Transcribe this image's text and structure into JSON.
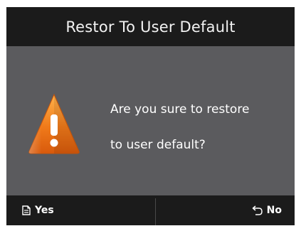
{
  "dialog": {
    "title": "Restor To User Default",
    "message_line1": "Are you sure to restore",
    "message_line2": "to user default?",
    "icon": "warning-icon"
  },
  "footer": {
    "yes_label": "Yes",
    "yes_icon": "document-icon",
    "no_label": "No",
    "no_icon": "back-arrow-icon"
  },
  "colors": {
    "title_bar": "#1b1b1b",
    "body": "#5b5b5e",
    "footer": "#1b1b1b",
    "warning": "#f07a1a"
  }
}
